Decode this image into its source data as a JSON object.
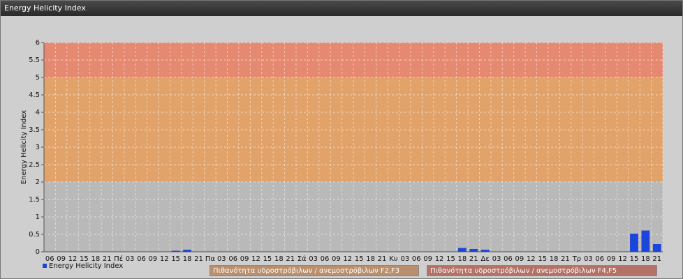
{
  "window": {
    "title": "Energy Helicity Index"
  },
  "colors": {
    "band_low": "#b9b9b9",
    "band_mid": "#e2a36b",
    "band_high": "#e68971",
    "bar": "#1c46d9",
    "band_legend_mid": "#b98f6d",
    "band_legend_high": "#b47166"
  },
  "legend": {
    "series_label": "Energy Helicity Index",
    "band_f2f3": "Πιθανότητα υδροστρόβιλων / ανεμοστρόβιλων F2,F3",
    "band_f4f5": "Πιθανότητα υδροστρόβιλων / ανεμοστρόβιλων F4,F5"
  },
  "chart_data": {
    "type": "bar",
    "ylabel": "Energy Helicity Index",
    "xlabel": "",
    "ylim": [
      0,
      6
    ],
    "yticks": [
      "0",
      "0.5",
      "1",
      "1.5",
      "2",
      "2.5",
      "3",
      "3.5",
      "4",
      "4.5",
      "5",
      "5.5",
      "6"
    ],
    "grid": true,
    "bands": [
      {
        "from": 0,
        "to": 2,
        "color": "#b9b9b9"
      },
      {
        "from": 2,
        "to": 5,
        "color": "#e2a36b"
      },
      {
        "from": 5,
        "to": 6,
        "color": "#e68971"
      }
    ],
    "categories": [
      "06",
      "09",
      "12",
      "15",
      "18",
      "21",
      "Πέ",
      "03",
      "06",
      "09",
      "12",
      "15",
      "18",
      "21",
      "Πα",
      "03",
      "06",
      "09",
      "12",
      "15",
      "18",
      "21",
      "Σά",
      "03",
      "06",
      "09",
      "12",
      "15",
      "18",
      "21",
      "Κυ",
      "03",
      "06",
      "09",
      "12",
      "15",
      "18",
      "21",
      "Δε",
      "03",
      "06",
      "09",
      "12",
      "15",
      "18",
      "21",
      "Τρ",
      "03",
      "06",
      "09",
      "12",
      "15",
      "18",
      "21"
    ],
    "series": [
      {
        "name": "Energy Helicity Index",
        "values": [
          0.01,
          0.01,
          0.01,
          0.01,
          0.01,
          0.01,
          0.01,
          0.01,
          0.01,
          0.01,
          0.01,
          0.03,
          0.06,
          0.01,
          0.01,
          0.01,
          0.01,
          0.01,
          0.01,
          0.01,
          0.01,
          0.01,
          0.01,
          0.01,
          0.01,
          0.01,
          0.01,
          0.01,
          0.01,
          0.01,
          0.01,
          0.01,
          0.01,
          0.01,
          0.01,
          0.01,
          0.11,
          0.08,
          0.06,
          0.01,
          0.01,
          0.01,
          0.01,
          0.01,
          0.01,
          0.01,
          0.01,
          0.01,
          0.01,
          0.01,
          0.01,
          0.52,
          0.61,
          0.22
        ]
      }
    ]
  }
}
